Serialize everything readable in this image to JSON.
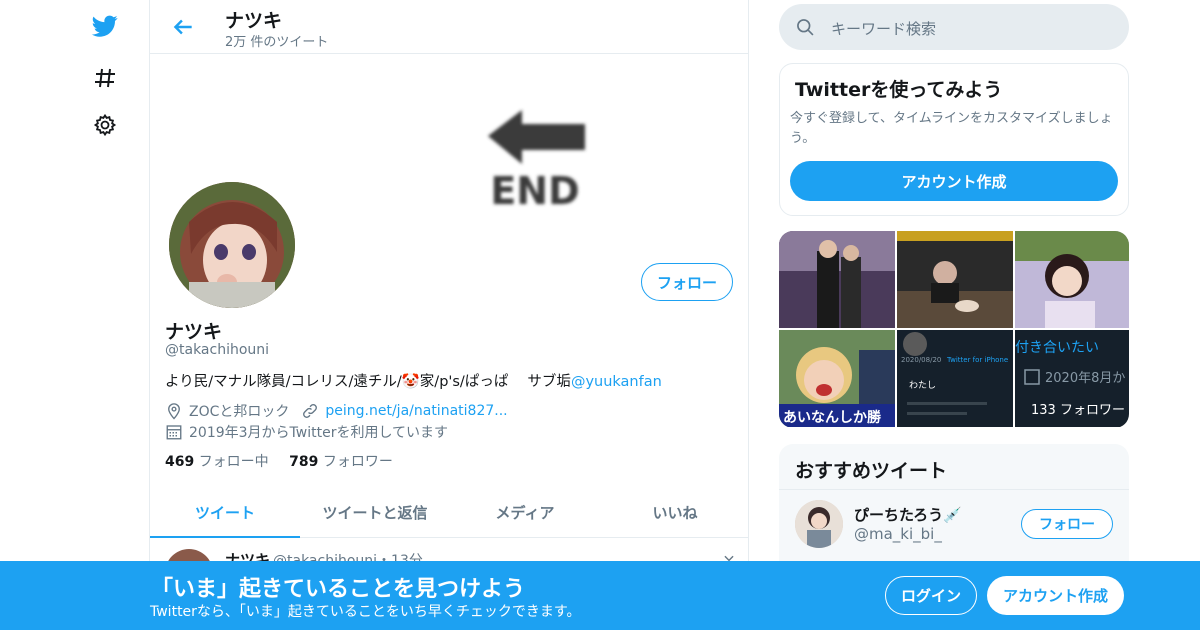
{
  "nav": {
    "icons": [
      "twitter-bird-icon",
      "hashtag-icon",
      "settings-gear-icon"
    ]
  },
  "header": {
    "name": "ナツキ",
    "tweet_count": "2万 件のツイート"
  },
  "banner": {
    "text": "END"
  },
  "profile": {
    "follow_label": "フォロー",
    "name": "ナツキ",
    "handle": "@takachihouni",
    "bio_text": "より民/マナル隊員/コレリス/遠チル/🤡家/p's/ぱっぱ　 サブ垢",
    "bio_link": "@yuukanfan",
    "location": "ZOCと邦ロック",
    "website": "peing.net/ja/natinati827...",
    "joined": "2019年3月からTwitterを利用しています",
    "following_count": "469",
    "following_label": "フォロー中",
    "followers_count": "789",
    "followers_label": "フォロワー"
  },
  "tabs": [
    {
      "label": "ツイート",
      "active": true
    },
    {
      "label": "ツイートと返信",
      "active": false
    },
    {
      "label": "メディア",
      "active": false
    },
    {
      "label": "いいね",
      "active": false
    }
  ],
  "tweet_peek": {
    "name": "ナツキ",
    "meta": "@takachihouni・13分"
  },
  "search": {
    "placeholder": "キーワード検索"
  },
  "signup_card": {
    "title": "Twitterを使ってみよう",
    "description": "今すぐ登録して、タイムラインをカスタマイズしましょう。",
    "button": "アカウント作成"
  },
  "media_grid": {
    "overlay_texts": [
      "あいなんしか勝",
      "付き合いたい",
      "2020年8月か",
      "133 フォロワー",
      "2020/08/20",
      "Twitter for iPhone",
      "わたし"
    ]
  },
  "recommended": {
    "title": "おすすめツイート",
    "user_name": "ぴーちたろう💉",
    "user_handle": "@ma_ki_bi_",
    "follow_label": "フォロー"
  },
  "bottom_bar": {
    "title": "「いま」起きていることを見つけよう",
    "subtitle": "Twitterなら、「いま」起きていることをいち早くチェックできます。",
    "login": "ログイン",
    "signup": "アカウント作成"
  },
  "colors": {
    "accent": "#1da1f2",
    "secondary_text": "#657786",
    "border": "#e6ecf0"
  }
}
